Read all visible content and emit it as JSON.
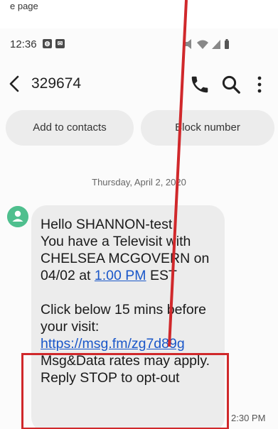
{
  "caption": "e page",
  "status_bar": {
    "time": "12:36",
    "notif_icons": [
      "whatsapp-icon",
      "mail-icon"
    ],
    "sys_icons": [
      "mute-icon",
      "wifi-icon",
      "signal-icon",
      "battery-icon"
    ]
  },
  "app_bar": {
    "contact": "329674",
    "actions": [
      "phone-icon",
      "search-icon",
      "more-vert-icon"
    ]
  },
  "chips": {
    "add_contacts": "Add to contacts",
    "block_number": "Block number"
  },
  "conversation": {
    "date": "Thursday, April 2, 2020",
    "message": {
      "line1": "Hello SHANNON-test",
      "line2": "You have a Televisit with",
      "line3": "CHELSEA MCGOVERN on",
      "line4_prefix": "04/02 at ",
      "line4_link": "1:00 PM",
      "line4_suffix": " EST",
      "line5": "Click below 15 mins before",
      "line6": "your visit:",
      "link": "https://msg.fm/zg7d89g",
      "line8": "Msg&Data rates may apply.",
      "line9": "Reply STOP to opt-out"
    },
    "time": "2:30 PM"
  },
  "colors": {
    "annotation_red": "#d0282b",
    "avatar_green": "#4fbf8e",
    "link_blue": "#1a57c9",
    "bubble_gray": "#ececec"
  }
}
